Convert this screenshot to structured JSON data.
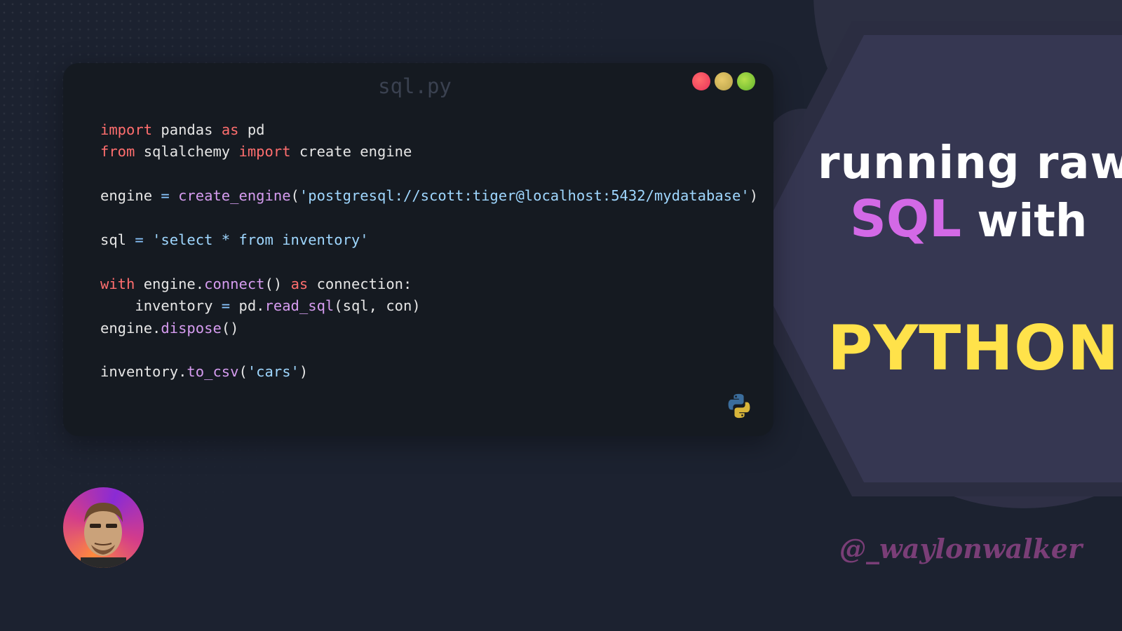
{
  "window": {
    "title": "sql.py",
    "language_icon": "python-icon"
  },
  "code_lines": [
    [
      {
        "t": "import",
        "c": "kw"
      },
      {
        "t": " pandas ",
        "c": ""
      },
      {
        "t": "as",
        "c": "kw"
      },
      {
        "t": " pd",
        "c": ""
      }
    ],
    [
      {
        "t": "from",
        "c": "kw"
      },
      {
        "t": " sqlalchemy ",
        "c": ""
      },
      {
        "t": "import",
        "c": "kw"
      },
      {
        "t": " create engine",
        "c": ""
      }
    ],
    [],
    [
      {
        "t": "engine ",
        "c": ""
      },
      {
        "t": "=",
        "c": "op"
      },
      {
        "t": " ",
        "c": ""
      },
      {
        "t": "create_engine",
        "c": "fn"
      },
      {
        "t": "(",
        "c": ""
      },
      {
        "t": "'postgresql://scott:tiger@localhost:5432/mydatabase'",
        "c": "str"
      },
      {
        "t": ")",
        "c": ""
      }
    ],
    [],
    [
      {
        "t": "sql ",
        "c": ""
      },
      {
        "t": "=",
        "c": "op"
      },
      {
        "t": " ",
        "c": ""
      },
      {
        "t": "'select * from inventory'",
        "c": "str"
      }
    ],
    [],
    [
      {
        "t": "with",
        "c": "kw"
      },
      {
        "t": " engine.",
        "c": ""
      },
      {
        "t": "connect",
        "c": "fn"
      },
      {
        "t": "() ",
        "c": ""
      },
      {
        "t": "as",
        "c": "kw"
      },
      {
        "t": " connection:",
        "c": ""
      }
    ],
    [
      {
        "t": "    inventory ",
        "c": ""
      },
      {
        "t": "=",
        "c": "op"
      },
      {
        "t": " pd.",
        "c": ""
      },
      {
        "t": "read_sql",
        "c": "fn"
      },
      {
        "t": "(sql, con)",
        "c": ""
      }
    ],
    [
      {
        "t": "engine.",
        "c": ""
      },
      {
        "t": "dispose",
        "c": "fn"
      },
      {
        "t": "()",
        "c": ""
      }
    ],
    [],
    [
      {
        "t": "inventory.",
        "c": ""
      },
      {
        "t": "to_csv",
        "c": "fn"
      },
      {
        "t": "(",
        "c": ""
      },
      {
        "t": "'cars'",
        "c": "str"
      },
      {
        "t": ")",
        "c": ""
      }
    ]
  ],
  "heading": {
    "line1": "running raw",
    "line2_highlight": "SQL",
    "line2_rest": " with",
    "line3": "PYTHON"
  },
  "handle": "@_waylonwalker",
  "colors": {
    "background": "#1c2230",
    "panel": "#151a21",
    "hexagon": "#353650",
    "sql_accent": "#d369e6",
    "python_accent": "#ffe24a",
    "handle": "#7a3e77"
  }
}
